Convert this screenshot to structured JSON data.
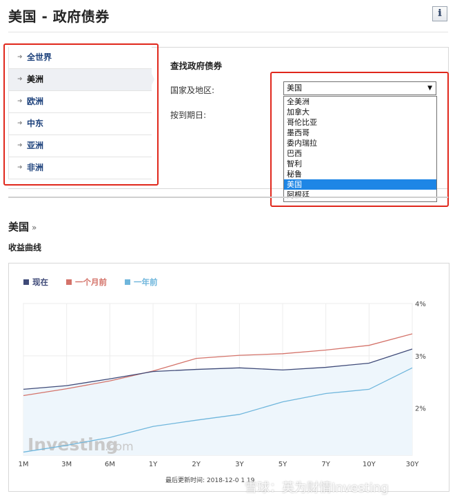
{
  "page": {
    "title": "美国 - 政府债券",
    "info_icon": "ℹ"
  },
  "regions": [
    {
      "label": "全世界",
      "active": false
    },
    {
      "label": "美洲",
      "active": true
    },
    {
      "label": "欧洲",
      "active": false
    },
    {
      "label": "中东",
      "active": false
    },
    {
      "label": "亚洲",
      "active": false
    },
    {
      "label": "非洲",
      "active": false
    }
  ],
  "finder": {
    "title": "查找政府债券",
    "country_label": "国家及地区:",
    "maturity_label": "按到期日:",
    "selected_country": "美国",
    "options": [
      "全美洲",
      "加拿大",
      "哥伦比亚",
      "墨西哥",
      "委内瑞拉",
      "巴西",
      "智利",
      "秘鲁",
      "美国",
      "阿根廷"
    ],
    "highlighted_option": "美国"
  },
  "section": {
    "title": "美国",
    "raquo": "»",
    "subtitle": "收益曲线"
  },
  "colors": {
    "now": "#3f4a78",
    "month_ago": "#d4736a",
    "year_ago": "#6fb6dc",
    "accent_red": "#e0261a",
    "link": "#1a3f7a"
  },
  "chart_data": {
    "type": "line",
    "categories": [
      "1M",
      "3M",
      "6M",
      "1Y",
      "2Y",
      "3Y",
      "5Y",
      "7Y",
      "10Y",
      "30Y"
    ],
    "series": [
      {
        "name": "现在",
        "color": "#3f4a78",
        "values": [
          2.36,
          2.43,
          2.56,
          2.7,
          2.74,
          2.77,
          2.73,
          2.78,
          2.86,
          3.13
        ]
      },
      {
        "name": "一个月前",
        "color": "#d4736a",
        "values": [
          2.24,
          2.37,
          2.52,
          2.71,
          2.95,
          3.01,
          3.04,
          3.11,
          3.2,
          3.42
        ]
      },
      {
        "name": "一年前",
        "color": "#6fb6dc",
        "values": [
          1.16,
          1.29,
          1.44,
          1.65,
          1.77,
          1.88,
          2.12,
          2.28,
          2.36,
          2.77
        ]
      }
    ],
    "y_ticks": [
      "4%",
      "3%",
      "2%"
    ],
    "y_tick_values": [
      4,
      3,
      2
    ],
    "ylim": [
      1.1,
      4.0
    ],
    "grid": true,
    "legend": "top-left",
    "watermark_left": "Investing",
    "watermark_right": ".com",
    "updated_text": "最后更新时间: 2018-12-0 1 19"
  },
  "watermark": "雪球：英为财情Investing"
}
